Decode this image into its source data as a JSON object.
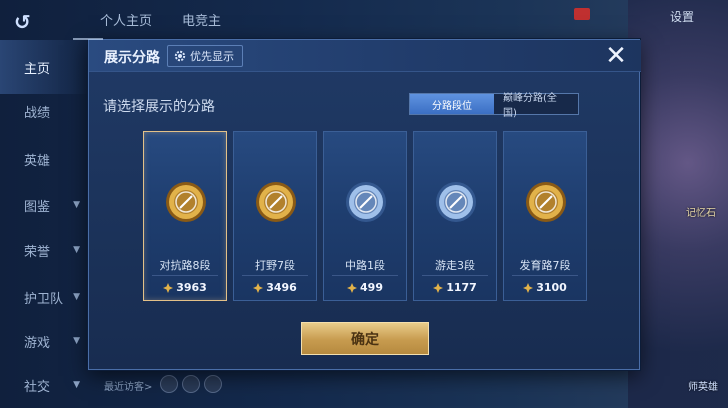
{
  "topnav": {
    "items": [
      "个人主页",
      "电竞主"
    ]
  },
  "settings_label": "设置",
  "sidebar": {
    "items": [
      "主页",
      "战绩",
      "英雄",
      "图鉴",
      "荣誉",
      "护卫队",
      "游戏",
      "社交"
    ]
  },
  "bg_right": {
    "label": "记忆石",
    "label2": "师英雄"
  },
  "bottom_hint": "最近访客>",
  "modal": {
    "title": "展示分路",
    "priority_label": "优先显示",
    "prompt": "请选择展示的分路",
    "tabs": [
      "分路段位",
      "巅峰分路(全国)"
    ],
    "active_tab": 0,
    "confirm_label": "确定"
  },
  "cards": [
    {
      "name": "对抗路8段",
      "score": "3963",
      "medal": "gold",
      "selected": true
    },
    {
      "name": "打野7段",
      "score": "3496",
      "medal": "gold",
      "selected": false
    },
    {
      "name": "中路1段",
      "score": "499",
      "medal": "silver",
      "selected": false
    },
    {
      "name": "游走3段",
      "score": "1177",
      "medal": "silver",
      "selected": false
    },
    {
      "name": "发育路7段",
      "score": "3100",
      "medal": "gold",
      "selected": false
    }
  ],
  "colors": {
    "gold": "#e2b24a",
    "silver": "#9fc0ea",
    "accent_tab": "#3b6fc4",
    "selected_border": "#e3c188"
  }
}
